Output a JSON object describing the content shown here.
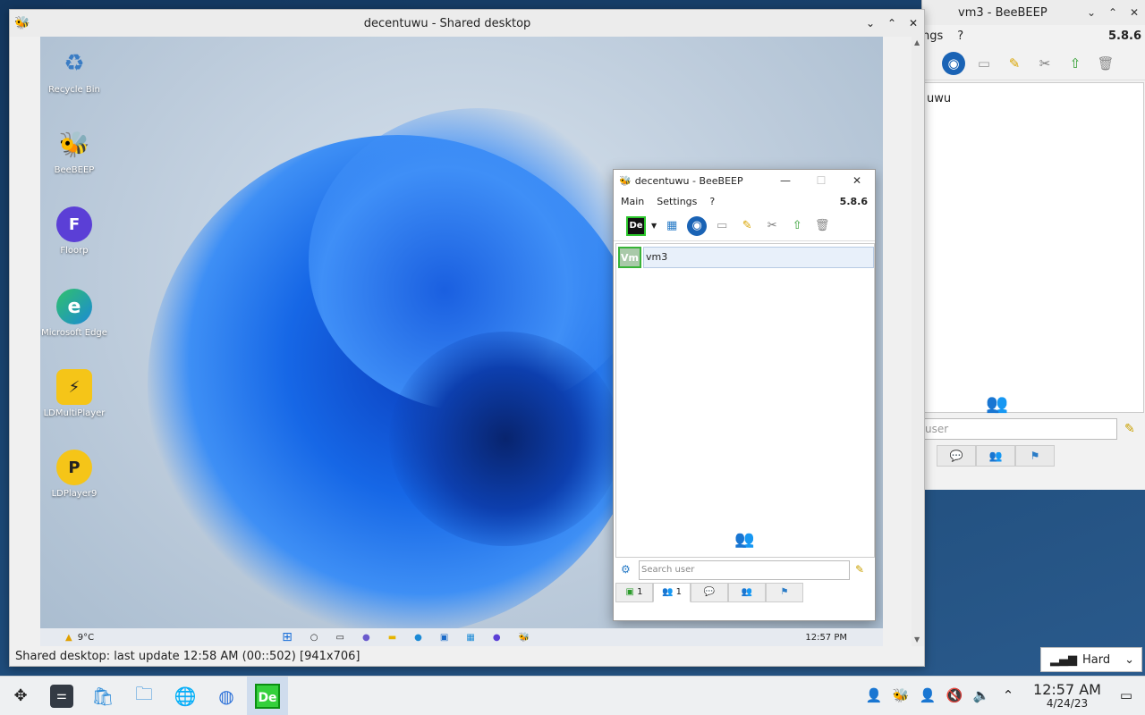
{
  "shared_window": {
    "title": "decentuwu - Shared desktop",
    "controls": [
      "⌄",
      "⌃",
      "✕"
    ],
    "status": "Shared desktop: last update 12:58 AM (00::502) [941x706]"
  },
  "remote_desktop": {
    "icons": [
      {
        "label": "Recycle Bin",
        "glyph": "♻",
        "color": "#e8eef5"
      },
      {
        "label": "BeeBEEP",
        "glyph": "🐝",
        "color": "#f5d76e"
      },
      {
        "label": "Floorp",
        "glyph": "F",
        "color": "#5b3fd6"
      },
      {
        "label": "Microsoft Edge",
        "glyph": "e",
        "color": "#1b8ad6"
      },
      {
        "label": "LDMultiPlayer",
        "glyph": "⚡",
        "color": "#f5c518"
      },
      {
        "label": "LDPlayer9",
        "glyph": "P",
        "color": "#f5c518"
      }
    ],
    "taskbar": {
      "weather": "9°C",
      "time": "12:57 PM"
    }
  },
  "bee_window": {
    "title": "decentuwu - BeeBEEP",
    "menu": [
      "Main",
      "Settings",
      "?"
    ],
    "version": "5.8.6",
    "avatar_label": "De",
    "users": [
      {
        "badge": "Vm",
        "name": "vm3"
      }
    ],
    "search_placeholder": "Search user",
    "tabs": [
      "1",
      "1",
      "",
      "",
      ""
    ]
  },
  "vm3_window": {
    "title": "vm3 - BeeBEEP",
    "menu": [
      "ngs",
      "?"
    ],
    "version": "5.8.6",
    "user_fragment": "uwu",
    "search_placeholder": "user",
    "combo_value": "Hard"
  },
  "host_taskbar": {
    "time": "12:57 AM",
    "date": "4/24/23",
    "active_app": "De"
  }
}
